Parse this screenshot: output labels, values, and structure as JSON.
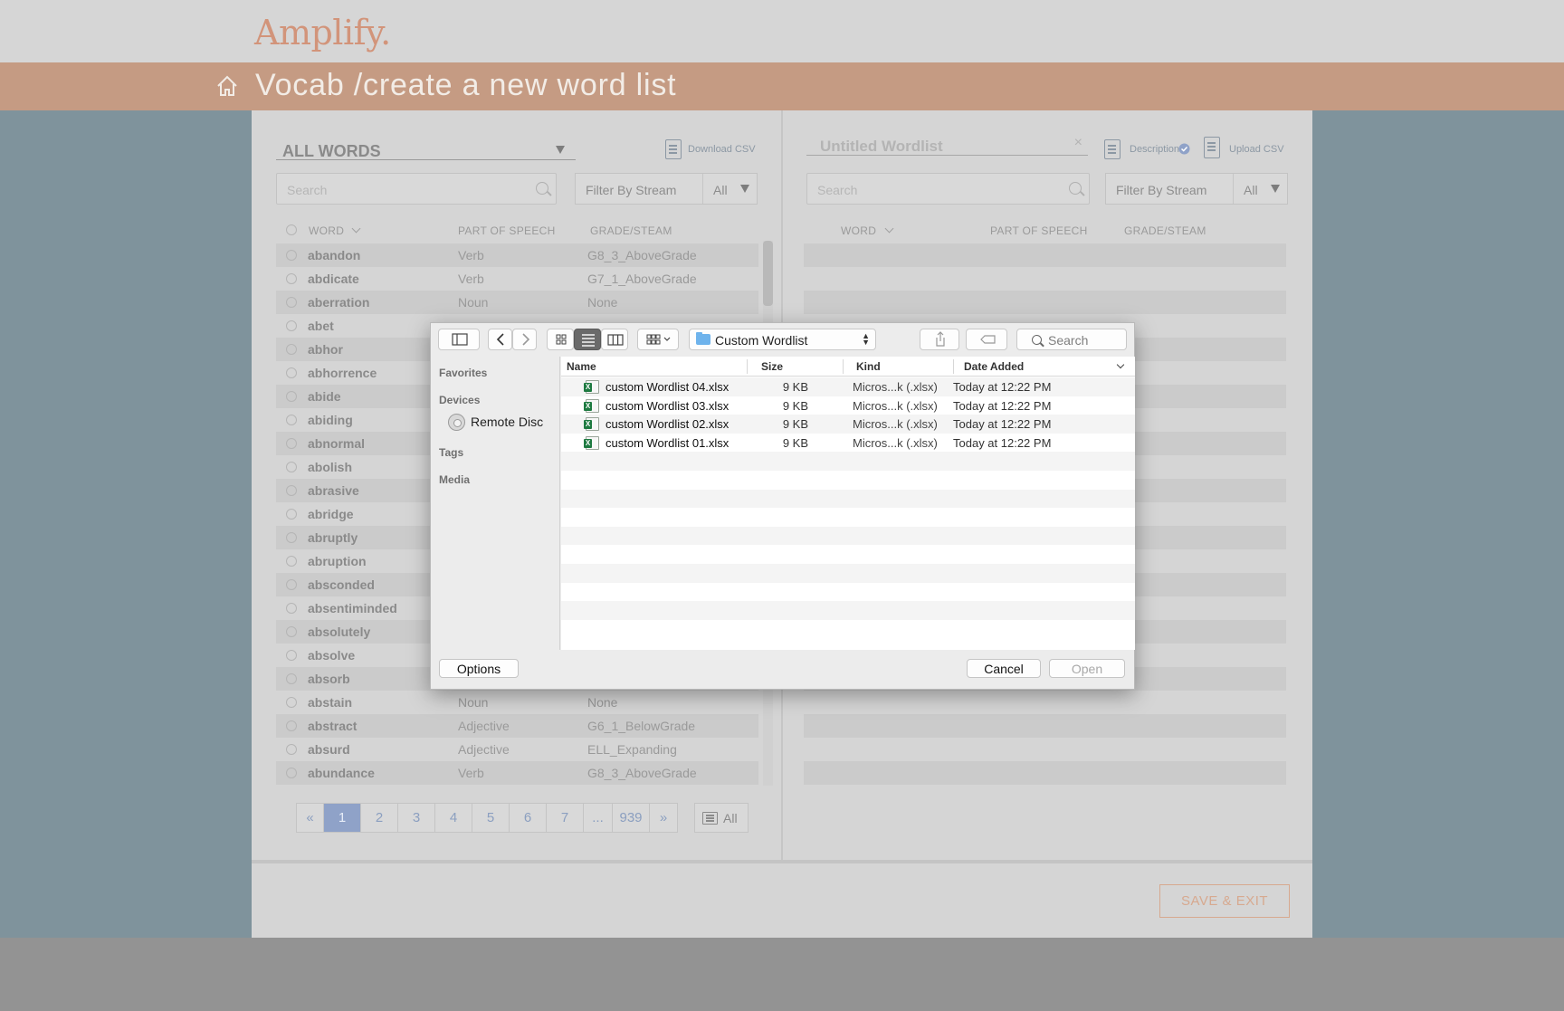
{
  "app": {
    "logo": "Amplify.",
    "title": "Vocab /create a new word list"
  },
  "left_panel": {
    "dropdown": "ALL WORDS",
    "download": "Download CSV",
    "search_placeholder": "Search",
    "filter_label": "Filter By Stream",
    "filter_value": "All",
    "columns": {
      "word": "WORD",
      "pos": "PART OF SPEECH",
      "grade": "GRADE/STEAM"
    },
    "rows": [
      {
        "word": "abandon",
        "pos": "Verb",
        "grade": "G8_3_AboveGrade"
      },
      {
        "word": "abdicate",
        "pos": "Verb",
        "grade": "G7_1_AboveGrade"
      },
      {
        "word": "aberration",
        "pos": "Noun",
        "grade": "None"
      },
      {
        "word": "abet",
        "pos": "",
        "grade": ""
      },
      {
        "word": "abhor",
        "pos": "",
        "grade": ""
      },
      {
        "word": "abhorrence",
        "pos": "",
        "grade": ""
      },
      {
        "word": "abide",
        "pos": "",
        "grade": ""
      },
      {
        "word": "abiding",
        "pos": "",
        "grade": ""
      },
      {
        "word": "abnormal",
        "pos": "",
        "grade": ""
      },
      {
        "word": "abolish",
        "pos": "",
        "grade": ""
      },
      {
        "word": "abrasive",
        "pos": "",
        "grade": ""
      },
      {
        "word": "abridge",
        "pos": "",
        "grade": ""
      },
      {
        "word": "abruptly",
        "pos": "",
        "grade": ""
      },
      {
        "word": "abruption",
        "pos": "",
        "grade": ""
      },
      {
        "word": "absconded",
        "pos": "",
        "grade": ""
      },
      {
        "word": "absentiminded",
        "pos": "",
        "grade": ""
      },
      {
        "word": "absolutely",
        "pos": "",
        "grade": ""
      },
      {
        "word": "absolve",
        "pos": "",
        "grade": ""
      },
      {
        "word": "absorb",
        "pos": "",
        "grade": ""
      },
      {
        "word": "abstain",
        "pos": "Noun",
        "grade": "None"
      },
      {
        "word": "abstract",
        "pos": "Adjective",
        "grade": "G6_1_BelowGrade"
      },
      {
        "word": "absurd",
        "pos": "Adjective",
        "grade": "ELL_Expanding"
      },
      {
        "word": "abundance",
        "pos": "Verb",
        "grade": "G8_3_AboveGrade"
      }
    ],
    "pagination": [
      "«",
      "1",
      "2",
      "3",
      "4",
      "5",
      "6",
      "7",
      "...",
      "939",
      "»"
    ],
    "current_page": "1",
    "all_button": "All"
  },
  "right_panel": {
    "title_placeholder": "Untitled Wordlist",
    "clear": "×",
    "description": "Description",
    "upload": "Upload CSV",
    "search_placeholder": "Search",
    "filter_label": "Filter By Stream",
    "filter_value": "All",
    "columns": {
      "word": "WORD",
      "pos": "PART OF SPEECH",
      "grade": "GRADE/STEAM"
    }
  },
  "footer": {
    "save_exit": "SAVE & EXIT"
  },
  "dialog": {
    "path": "Custom Wordlist",
    "search_placeholder": "Search",
    "sidebar": {
      "favorites": "Favorites",
      "devices": "Devices",
      "remote_disc": "Remote Disc",
      "tags": "Tags",
      "media": "Media"
    },
    "columns": {
      "name": "Name",
      "size": "Size",
      "kind": "Kind",
      "date": "Date Added"
    },
    "files": [
      {
        "name": "custom Wordlist 04.xlsx",
        "size": "9 KB",
        "kind": "Micros...k (.xlsx)",
        "date": "Today at 12:22 PM"
      },
      {
        "name": "custom Wordlist 03.xlsx",
        "size": "9 KB",
        "kind": "Micros...k (.xlsx)",
        "date": "Today at 12:22 PM"
      },
      {
        "name": "custom Wordlist 02.xlsx",
        "size": "9 KB",
        "kind": "Micros...k (.xlsx)",
        "date": "Today at 12:22 PM"
      },
      {
        "name": "custom Wordlist 01.xlsx",
        "size": "9 KB",
        "kind": "Micros...k (.xlsx)",
        "date": "Today at 12:22 PM"
      }
    ],
    "options": "Options",
    "cancel": "Cancel",
    "open": "Open"
  },
  "colors": {
    "brand_orange": "#c59b83",
    "logo": "#d2947a",
    "backdrop_blue": "#7f939c",
    "page_active": "#8fa2c8"
  }
}
